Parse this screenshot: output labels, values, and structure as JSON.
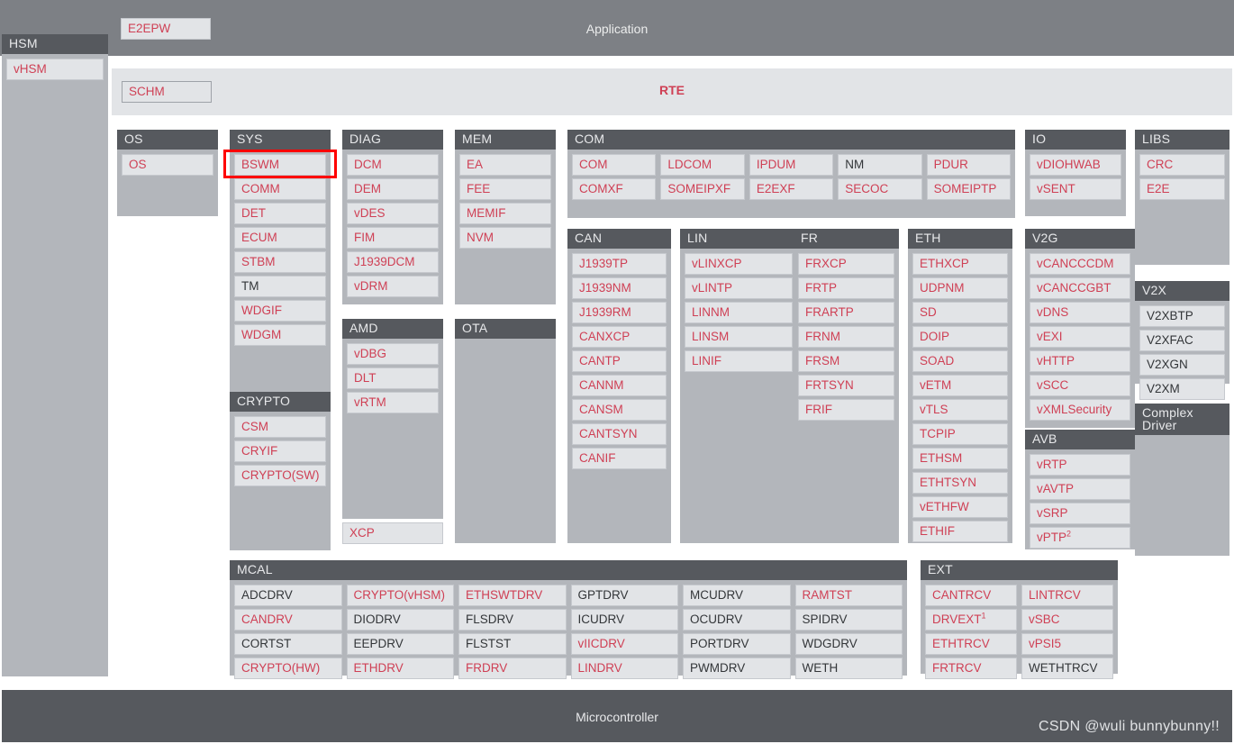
{
  "top": {
    "application_label": "Application",
    "e2epw_label": "E2EPW",
    "rte_label": "RTE",
    "schm_label": "SCHM"
  },
  "bottom": {
    "microcontroller_label": "Microcontroller",
    "watermark": "CSDN @wuli  bunnybunny!!"
  },
  "colors": {
    "module_text_red": "#cf4055",
    "module_text_dark": "#333639",
    "header_bg": "#56595e",
    "group_bg": "#b3b6bb",
    "cell_bg": "#e2e4e7",
    "appbar_bg": "#7d8085",
    "rte_bg": "#e2e4e7",
    "highlight": "#ff0000"
  },
  "highlight": {
    "target": "BSWM"
  },
  "hsm": {
    "title": "HSM",
    "items": [
      {
        "label": "vHSM",
        "style": "red"
      }
    ]
  },
  "groups": {
    "os": {
      "title": "OS",
      "items": [
        {
          "label": "OS",
          "style": "red"
        }
      ]
    },
    "sys": {
      "title": "SYS",
      "items": [
        {
          "label": "BSWM",
          "style": "red"
        },
        {
          "label": "COMM",
          "style": "red"
        },
        {
          "label": "DET",
          "style": "red"
        },
        {
          "label": "ECUM",
          "style": "red"
        },
        {
          "label": "STBM",
          "style": "red"
        },
        {
          "label": "TM",
          "style": "dark"
        },
        {
          "label": "WDGIF",
          "style": "red"
        },
        {
          "label": "WDGM",
          "style": "red"
        }
      ]
    },
    "diag": {
      "title": "DIAG",
      "items": [
        {
          "label": "DCM",
          "style": "red"
        },
        {
          "label": "DEM",
          "style": "red"
        },
        {
          "label": "vDES",
          "style": "red"
        },
        {
          "label": "FIM",
          "style": "red"
        },
        {
          "label": "J1939DCM",
          "style": "red"
        },
        {
          "label": "vDRM",
          "style": "red"
        }
      ]
    },
    "mem": {
      "title": "MEM",
      "items": [
        {
          "label": "EA",
          "style": "red"
        },
        {
          "label": "FEE",
          "style": "red"
        },
        {
          "label": "MEMIF",
          "style": "red"
        },
        {
          "label": "NVM",
          "style": "red"
        }
      ]
    },
    "com": {
      "title": "COM",
      "columns": [
        [
          {
            "label": "COM",
            "style": "red"
          },
          {
            "label": "COMXF",
            "style": "red"
          }
        ],
        [
          {
            "label": "LDCOM",
            "style": "red"
          },
          {
            "label": "SOMEIPXF",
            "style": "red"
          }
        ],
        [
          {
            "label": "IPDUM",
            "style": "red"
          },
          {
            "label": "E2EXF",
            "style": "red"
          }
        ],
        [
          {
            "label": "NM",
            "style": "dark"
          },
          {
            "label": "SECOC",
            "style": "red"
          }
        ],
        [
          {
            "label": "PDUR",
            "style": "red"
          },
          {
            "label": "SOMEIPTP",
            "style": "red"
          }
        ]
      ]
    },
    "io": {
      "title": "IO",
      "items": [
        {
          "label": "vDIOHWAB",
          "style": "red"
        },
        {
          "label": "vSENT",
          "style": "red"
        }
      ]
    },
    "libs": {
      "title": "LIBS",
      "items": [
        {
          "label": "CRC",
          "style": "red"
        },
        {
          "label": "E2E",
          "style": "red"
        }
      ]
    },
    "can": {
      "title": "CAN",
      "items": [
        {
          "label": "J1939TP",
          "style": "red"
        },
        {
          "label": "J1939NM",
          "style": "red"
        },
        {
          "label": "J1939RM",
          "style": "red"
        },
        {
          "label": "CANXCP",
          "style": "red"
        },
        {
          "label": "CANTP",
          "style": "red"
        },
        {
          "label": "CANNM",
          "style": "red"
        },
        {
          "label": "CANSM",
          "style": "red"
        },
        {
          "label": "CANTSYN",
          "style": "red"
        },
        {
          "label": "CANIF",
          "style": "red"
        }
      ]
    },
    "lin": {
      "title": "LIN",
      "items": [
        {
          "label": "vLINXCP",
          "style": "red"
        },
        {
          "label": "vLINTP",
          "style": "red"
        },
        {
          "label": "LINNM",
          "style": "red"
        },
        {
          "label": "LINSM",
          "style": "red"
        },
        {
          "label": "LINIF",
          "style": "red"
        }
      ]
    },
    "fr": {
      "title": "FR",
      "items": [
        {
          "label": "FRXCP",
          "style": "red"
        },
        {
          "label": "FRTP",
          "style": "red"
        },
        {
          "label": "FRARTP",
          "style": "red"
        },
        {
          "label": "FRNM",
          "style": "red"
        },
        {
          "label": "FRSM",
          "style": "red"
        },
        {
          "label": "FRTSYN",
          "style": "red"
        },
        {
          "label": "FRIF",
          "style": "red"
        }
      ]
    },
    "eth": {
      "title": "ETH",
      "items": [
        {
          "label": "ETHXCP",
          "style": "red"
        },
        {
          "label": "UDPNM",
          "style": "red"
        },
        {
          "label": "SD",
          "style": "red"
        },
        {
          "label": "DOIP",
          "style": "red"
        },
        {
          "label": "SOAD",
          "style": "red"
        },
        {
          "label": "vETM",
          "style": "red"
        },
        {
          "label": "vTLS",
          "style": "red"
        },
        {
          "label": "TCPIP",
          "style": "red"
        },
        {
          "label": "ETHSM",
          "style": "red"
        },
        {
          "label": "ETHTSYN",
          "style": "red"
        },
        {
          "label": "vETHFW",
          "style": "red"
        },
        {
          "label": "ETHIF",
          "style": "red"
        }
      ]
    },
    "v2g": {
      "title": "V2G",
      "items": [
        {
          "label": "vCANCCCDM",
          "style": "red"
        },
        {
          "label": "vCANCCGBT",
          "style": "red"
        },
        {
          "label": "vDNS",
          "style": "red"
        },
        {
          "label": "vEXI",
          "style": "red"
        },
        {
          "label": "vHTTP",
          "style": "red"
        },
        {
          "label": "vSCC",
          "style": "red"
        },
        {
          "label": "vXMLSecurity",
          "style": "red"
        }
      ]
    },
    "v2x": {
      "title": "V2X",
      "items": [
        {
          "label": "V2XBTP",
          "style": "dark"
        },
        {
          "label": "V2XFAC",
          "style": "dark"
        },
        {
          "label": "V2XGN",
          "style": "dark"
        },
        {
          "label": "V2XM",
          "style": "dark"
        }
      ]
    },
    "complex_driver": {
      "title": "Complex Driver",
      "items": []
    },
    "avb": {
      "title": "AVB",
      "items": [
        {
          "label": "vRTP",
          "style": "red"
        },
        {
          "label": "vAVTP",
          "style": "red"
        },
        {
          "label": "vSRP",
          "style": "red"
        },
        {
          "label": "vPTP",
          "style": "red",
          "sup": "2"
        }
      ]
    },
    "crypto": {
      "title": "CRYPTO",
      "items": [
        {
          "label": "CSM",
          "style": "red"
        },
        {
          "label": "CRYIF",
          "style": "red"
        },
        {
          "label": "CRYPTO(SW)",
          "style": "red"
        }
      ]
    },
    "amd": {
      "title": "AMD",
      "items": [
        {
          "label": "vDBG",
          "style": "red"
        },
        {
          "label": "DLT",
          "style": "red"
        },
        {
          "label": "vRTM",
          "style": "red"
        }
      ]
    },
    "xcp": {
      "label": "XCP",
      "style": "red"
    },
    "ota": {
      "title": "OTA",
      "items": []
    },
    "mcal": {
      "title": "MCAL",
      "columns": [
        [
          {
            "label": "ADCDRV",
            "style": "dark"
          },
          {
            "label": "CANDRV",
            "style": "red"
          },
          {
            "label": "CORTST",
            "style": "dark"
          },
          {
            "label": "CRYPTO(HW)",
            "style": "red"
          }
        ],
        [
          {
            "label": "CRYPTO(vHSM)",
            "style": "red"
          },
          {
            "label": "DIODRV",
            "style": "dark"
          },
          {
            "label": "EEPDRV",
            "style": "dark"
          },
          {
            "label": "ETHDRV",
            "style": "red"
          }
        ],
        [
          {
            "label": "ETHSWTDRV",
            "style": "red"
          },
          {
            "label": "FLSDRV",
            "style": "dark"
          },
          {
            "label": "FLSTST",
            "style": "dark"
          },
          {
            "label": "FRDRV",
            "style": "red"
          }
        ],
        [
          {
            "label": "GPTDRV",
            "style": "dark"
          },
          {
            "label": "ICUDRV",
            "style": "dark"
          },
          {
            "label": "vIICDRV",
            "style": "red"
          },
          {
            "label": "LINDRV",
            "style": "red"
          }
        ],
        [
          {
            "label": "MCUDRV",
            "style": "dark"
          },
          {
            "label": "OCUDRV",
            "style": "dark"
          },
          {
            "label": "PORTDRV",
            "style": "dark"
          },
          {
            "label": "PWMDRV",
            "style": "dark"
          }
        ],
        [
          {
            "label": "RAMTST",
            "style": "red"
          },
          {
            "label": "SPIDRV",
            "style": "dark"
          },
          {
            "label": "WDGDRV",
            "style": "dark"
          },
          {
            "label": "WETH",
            "style": "dark"
          }
        ]
      ]
    },
    "ext": {
      "title": "EXT",
      "columns": [
        [
          {
            "label": "CANTRCV",
            "style": "red"
          },
          {
            "label": "DRVEXT",
            "style": "red",
            "sup": "1"
          },
          {
            "label": "ETHTRCV",
            "style": "red"
          },
          {
            "label": "FRTRCV",
            "style": "red"
          }
        ],
        [
          {
            "label": "LINTRCV",
            "style": "red"
          },
          {
            "label": "vSBC",
            "style": "red"
          },
          {
            "label": "vPSI5",
            "style": "red"
          },
          {
            "label": "WETHTRCV",
            "style": "dark"
          }
        ]
      ]
    }
  }
}
